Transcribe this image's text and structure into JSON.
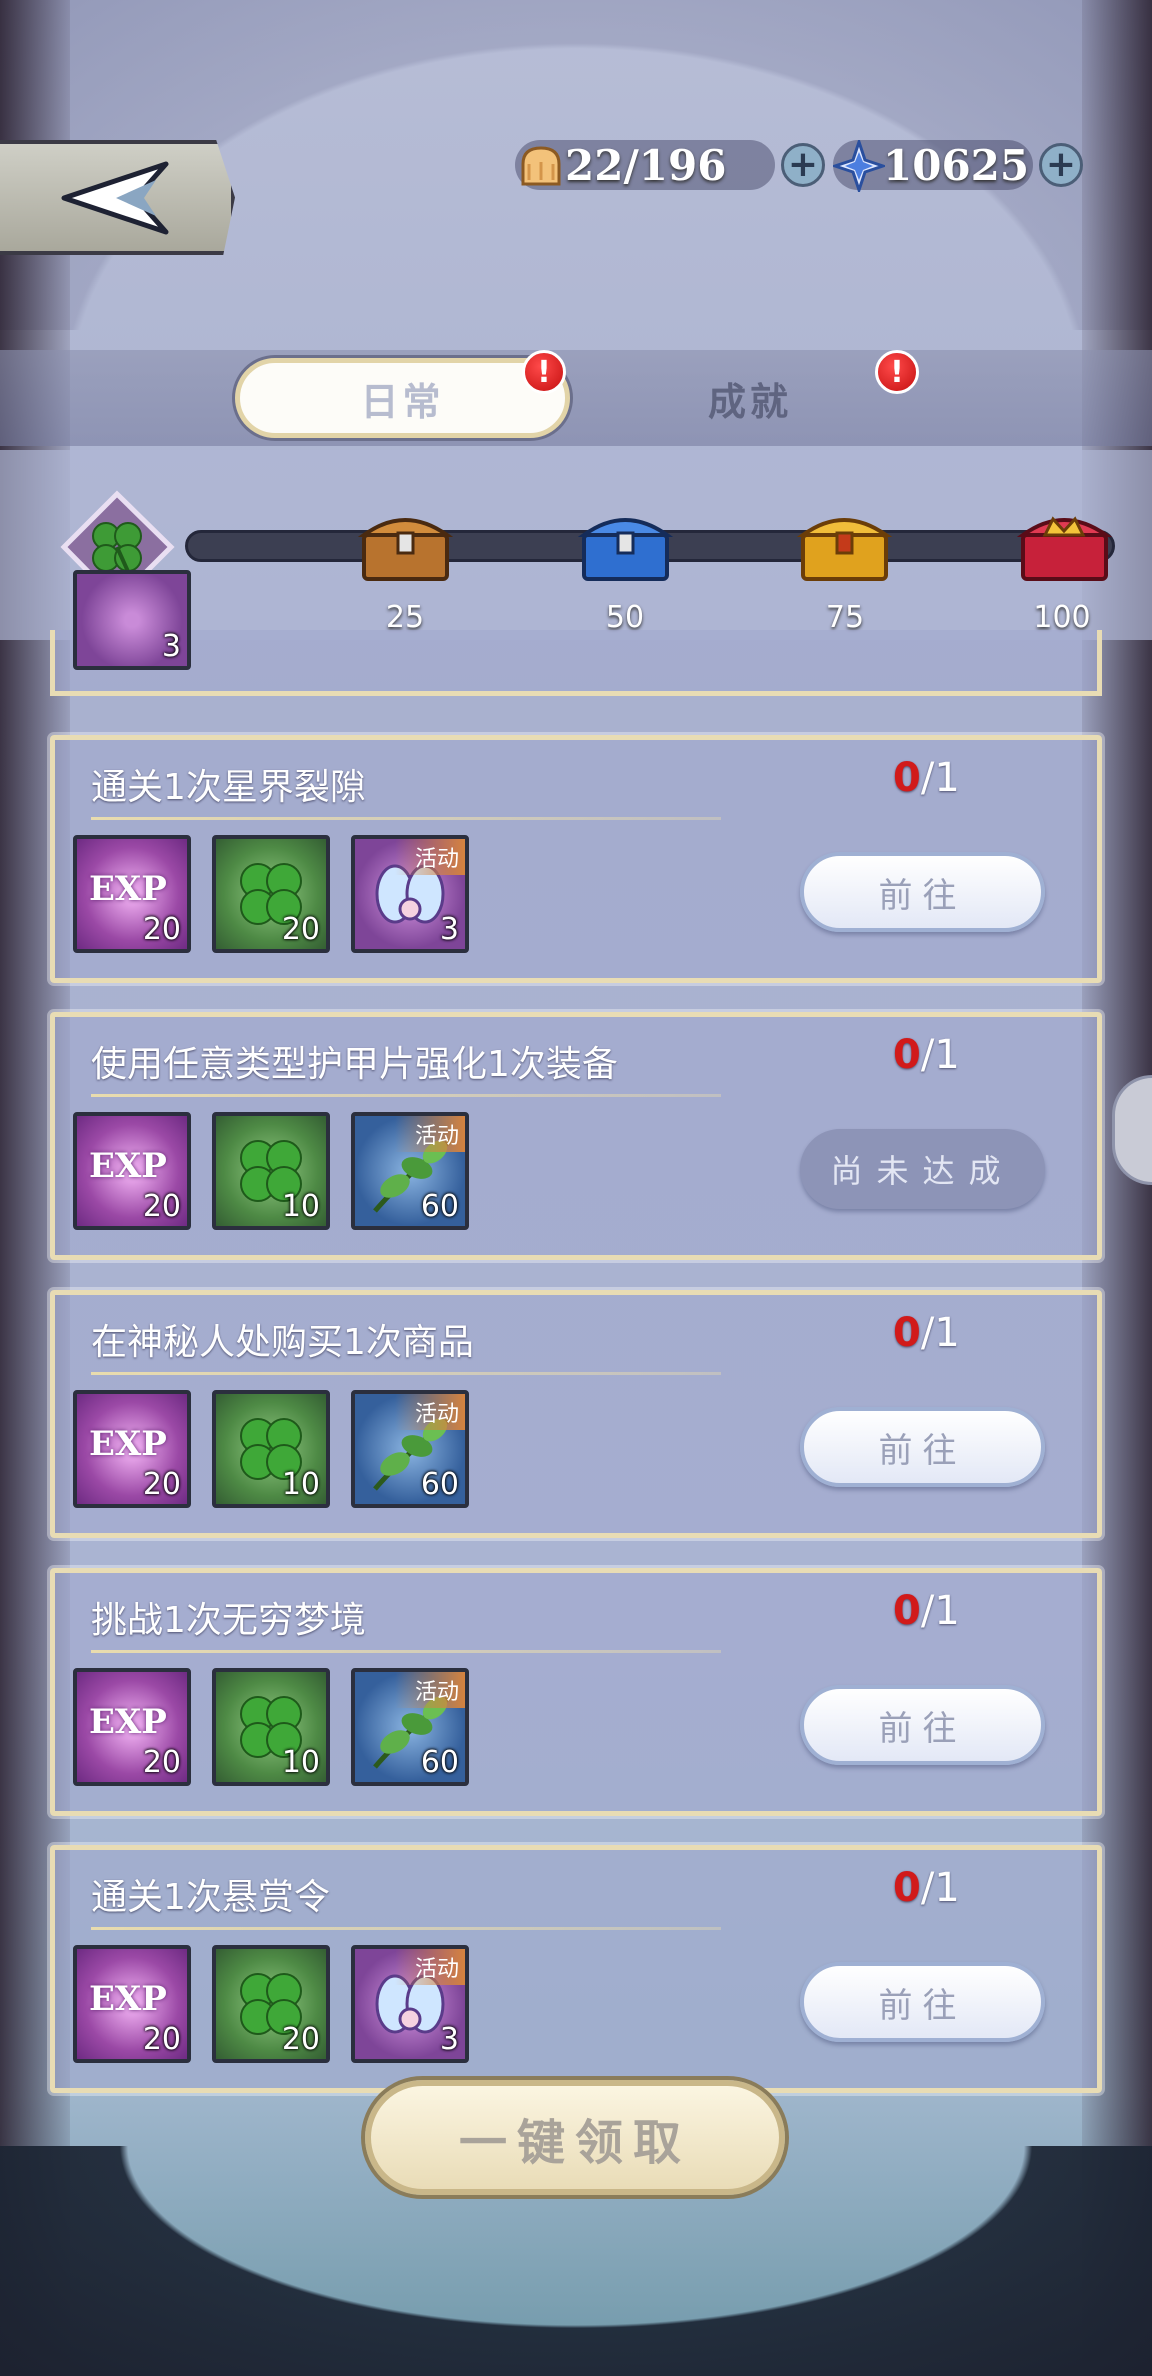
{
  "currency": {
    "stamina": "22/196",
    "diamonds": "10625",
    "add_label": "+"
  },
  "tabs": [
    {
      "label": "日常",
      "alert": "!"
    },
    {
      "label": "成就",
      "alert": "!"
    }
  ],
  "activity": {
    "points": "0",
    "milestones": [
      "25",
      "50",
      "75",
      "100"
    ]
  },
  "partial_card_count": "3",
  "tasks": [
    {
      "title": "通关1次星界裂隙",
      "current": "0",
      "total": "/1",
      "rewards": [
        {
          "type": "exp",
          "label": "EXP",
          "count": "20"
        },
        {
          "type": "clover",
          "count": "20"
        },
        {
          "type": "event-purple",
          "tag": "活动",
          "count": "3"
        }
      ],
      "button": "前往"
    },
    {
      "title": "使用任意类型护甲片强化1次装备",
      "current": "0",
      "total": "/1",
      "rewards": [
        {
          "type": "exp",
          "label": "EXP",
          "count": "20"
        },
        {
          "type": "clover",
          "count": "10"
        },
        {
          "type": "event-blue",
          "tag": "活动",
          "count": "60"
        }
      ],
      "button": "尚未达成"
    },
    {
      "title": "在神秘人处购买1次商品",
      "current": "0",
      "total": "/1",
      "rewards": [
        {
          "type": "exp",
          "label": "EXP",
          "count": "20"
        },
        {
          "type": "clover",
          "count": "10"
        },
        {
          "type": "event-blue",
          "tag": "活动",
          "count": "60"
        }
      ],
      "button": "前往"
    },
    {
      "title": "挑战1次无穷梦境",
      "current": "0",
      "total": "/1",
      "rewards": [
        {
          "type": "exp",
          "label": "EXP",
          "count": "20"
        },
        {
          "type": "clover",
          "count": "10"
        },
        {
          "type": "event-blue",
          "tag": "活动",
          "count": "60"
        }
      ],
      "button": "前往"
    },
    {
      "title": "通关1次悬赏令",
      "current": "0",
      "total": "/1",
      "rewards": [
        {
          "type": "exp",
          "label": "EXP",
          "count": "20"
        },
        {
          "type": "clover",
          "count": "20"
        },
        {
          "type": "event-purple",
          "tag": "活动",
          "count": "3"
        }
      ],
      "button": "前往"
    }
  ],
  "claim_all_label": "一键领取",
  "colors": {
    "progress_current": "#d11a1a",
    "alert": "#e01818",
    "card_border": "#e8dcb4"
  }
}
